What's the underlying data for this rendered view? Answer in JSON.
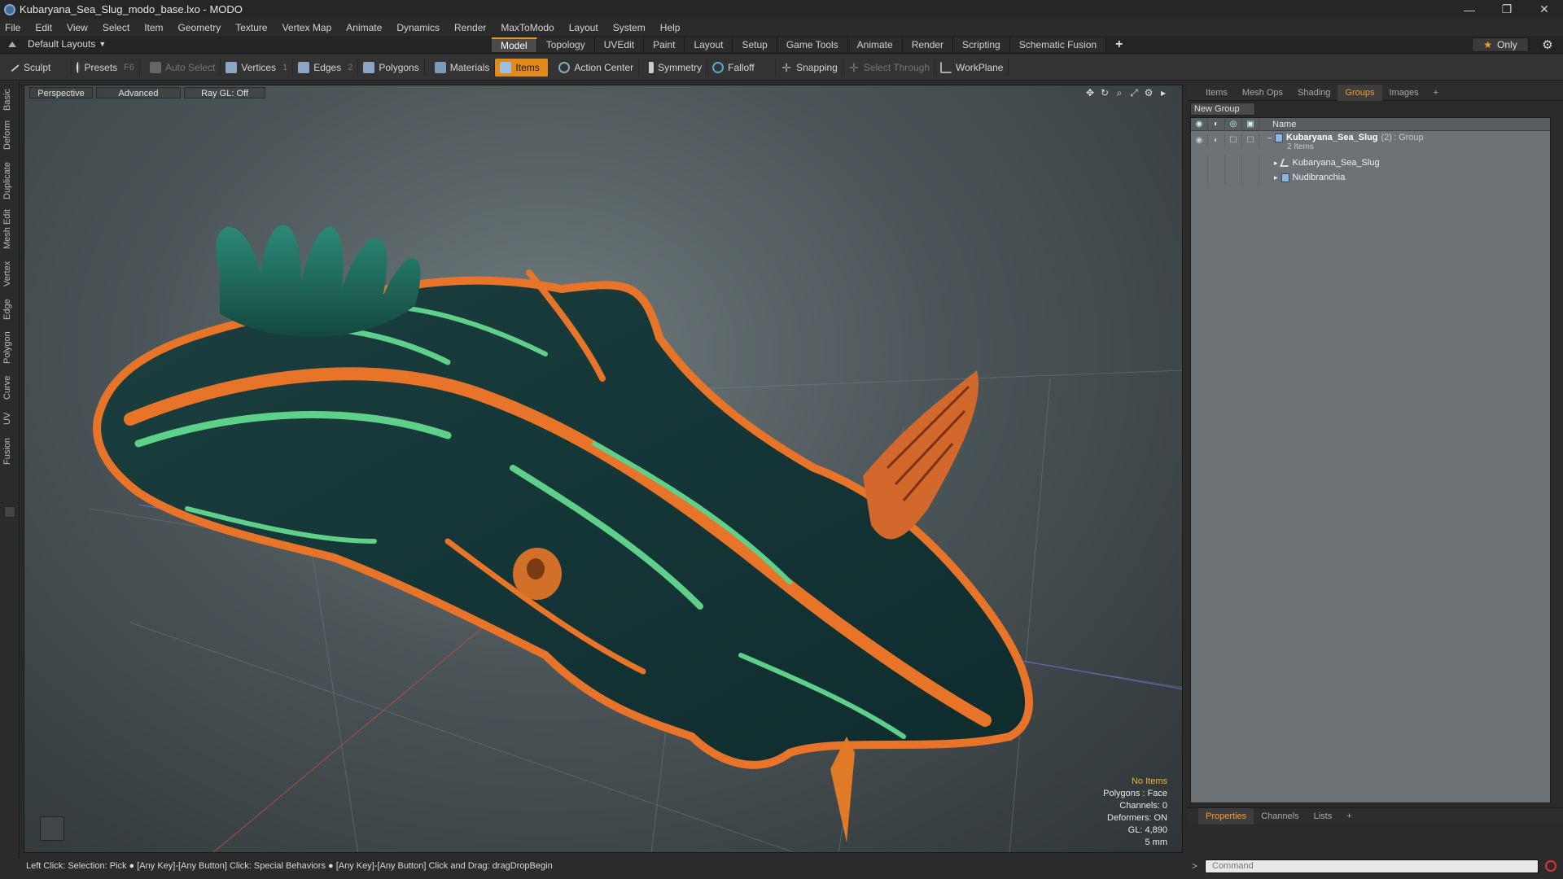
{
  "window": {
    "title": "Kubaryana_Sea_Slug_modo_base.lxo - MODO",
    "controls": [
      "—",
      "❐",
      "✕"
    ]
  },
  "menu": [
    "File",
    "Edit",
    "View",
    "Select",
    "Item",
    "Geometry",
    "Texture",
    "Vertex Map",
    "Animate",
    "Dynamics",
    "Render",
    "MaxToModo",
    "Layout",
    "System",
    "Help"
  ],
  "layout_selector": "Default Layouts",
  "workspace_tabs": [
    "Model",
    "Topology",
    "UVEdit",
    "Paint",
    "Layout",
    "Setup",
    "Game Tools",
    "Animate",
    "Render",
    "Scripting",
    "Schematic Fusion"
  ],
  "workspace_tab_active": "Model",
  "add_tab": "+",
  "only_button": "Only",
  "toolbar": {
    "sculpt": "Sculpt",
    "presets": "Presets",
    "presets_key": "F6",
    "auto_select": "Auto Select",
    "vertices": "Vertices",
    "vertices_key": "1",
    "edges": "Edges",
    "edges_key": "2",
    "polygons": "Polygons",
    "materials": "Materials",
    "items": "Items",
    "action_center": "Action Center",
    "symmetry": "Symmetry",
    "falloff": "Falloff",
    "snapping": "Snapping",
    "select_through": "Select Through",
    "workplane": "WorkPlane"
  },
  "left_tabs": [
    "Basic",
    "Deform",
    "Duplicate",
    "Mesh Edit",
    "Vertex",
    "Edge",
    "Polygon",
    "Curve",
    "UV",
    "Fusion"
  ],
  "viewport": {
    "view_mode": "Perspective",
    "shading": "Advanced",
    "raygl": "Ray GL: Off",
    "info": {
      "selection": "No Items",
      "polygons": "Polygons : Face",
      "channels": "Channels: 0",
      "deformers": "Deformers: ON",
      "gl": "GL: 4,890",
      "scale": "5 mm"
    }
  },
  "status_bar": "Left Click: Selection: Pick ● [Any Key]-[Any Button] Click: Special Behaviors ● [Any Key]-[Any Button] Click and Drag: dragDropBegin",
  "right_panel": {
    "tabs": [
      "Items",
      "Mesh Ops",
      "Shading",
      "Groups",
      "Images"
    ],
    "active_tab": "Groups",
    "add": "+",
    "new_group": "New Group",
    "column_name": "Name",
    "tree": {
      "group_name": "Kubaryana_Sea_Slug",
      "group_count": "(2)",
      "group_type": ": Group",
      "group_sub": "2 Items",
      "children": [
        "Kubaryana_Sea_Slug",
        "Nudibranchia"
      ]
    }
  },
  "bottom_tabs": [
    "Properties",
    "Channels",
    "Lists"
  ],
  "bottom_active": "Properties",
  "command_placeholder": "Command",
  "colors": {
    "accent": "#e48a1c",
    "slug_dark": "#153b3a",
    "slug_green": "#5fd08a",
    "slug_orange": "#e8742a",
    "gills": "#1e6a5c"
  }
}
